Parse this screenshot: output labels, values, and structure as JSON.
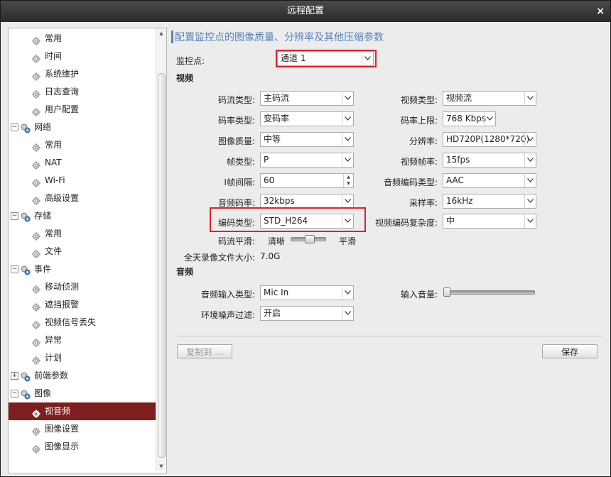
{
  "window": {
    "title": "远程配置",
    "close_label": "×"
  },
  "sidebar": {
    "items": [
      {
        "label": "常用",
        "level": 1
      },
      {
        "label": "时间",
        "level": 1
      },
      {
        "label": "系统维护",
        "level": 1
      },
      {
        "label": "日志查询",
        "level": 1
      },
      {
        "label": "用户配置",
        "level": 1
      },
      {
        "label": "网络",
        "level": 0,
        "expander": "−"
      },
      {
        "label": "常用",
        "level": 1
      },
      {
        "label": "NAT",
        "level": 1
      },
      {
        "label": "Wi-Fi",
        "level": 1
      },
      {
        "label": "高级设置",
        "level": 1
      },
      {
        "label": "存储",
        "level": 0,
        "expander": "−"
      },
      {
        "label": "常用",
        "level": 1
      },
      {
        "label": "文件",
        "level": 1
      },
      {
        "label": "事件",
        "level": 0,
        "expander": "−"
      },
      {
        "label": "移动侦测",
        "level": 1
      },
      {
        "label": "遮挡报警",
        "level": 1
      },
      {
        "label": "视频信号丢失",
        "level": 1
      },
      {
        "label": "异常",
        "level": 1
      },
      {
        "label": "计划",
        "level": 1
      },
      {
        "label": "前端参数",
        "level": 0,
        "expander": "+"
      },
      {
        "label": "图像",
        "level": 0,
        "expander": "−"
      },
      {
        "label": "视音频",
        "level": 1,
        "selected": true
      },
      {
        "label": "图像设置",
        "level": 1
      },
      {
        "label": "图像显示",
        "level": 1
      }
    ]
  },
  "main": {
    "heading": "配置监控点的图像质量、分辨率及其他压缩参数",
    "camera_label": "监控点:",
    "camera_value": "通道 1",
    "video_section": "视频",
    "stream_type_label": "码流类型:",
    "stream_type_value": "主码流",
    "bitrate_type_label": "码率类型:",
    "bitrate_type_value": "变码率",
    "quality_label": "图像质量:",
    "quality_value": "中等",
    "frame_type_label": "帧类型:",
    "frame_type_value": "P",
    "iframe_interval_label": "I帧间隔:",
    "iframe_interval_value": "60",
    "audio_bitrate_label": "音频码率:",
    "audio_bitrate_value": "32kbps",
    "encode_type_label": "编码类型:",
    "encode_type_value": "STD_H264",
    "smoothing_label": "码流平滑:",
    "smoothing_left": "清晰",
    "smoothing_right": "平滑",
    "smoothing_level": 0.5,
    "file_size_label": "全天录像文件大小:",
    "file_size_value": "7.0G",
    "video_type_label": "视频类型:",
    "video_type_value": "视频流",
    "max_bitrate_label": "码率上限:",
    "max_bitrate_value": "768 Kbps",
    "resolution_label": "分辨率:",
    "resolution_value": "HD720P(1280*720)",
    "frame_rate_label": "视频帧率:",
    "frame_rate_value": "15fps",
    "audio_encode_label": "音频编码类型:",
    "audio_encode_value": "AAC",
    "sample_rate_label": "采样率:",
    "sample_rate_value": "16kHz",
    "complexity_label": "视频编码复杂度:",
    "complexity_value": "中",
    "audio_section": "音频",
    "audio_input_label": "音频输入类型:",
    "audio_input_value": "Mic In",
    "noise_filter_label": "环境噪声过滤:",
    "noise_filter_value": "开启",
    "input_volume_label": "输入音量:",
    "input_volume_level": 0.0,
    "copy_button": "复制到 ...",
    "save_button": "保存"
  },
  "colors": {
    "accent": "#5a84b8",
    "selected": "#7d1f1f",
    "highlight": "#e0202a"
  }
}
